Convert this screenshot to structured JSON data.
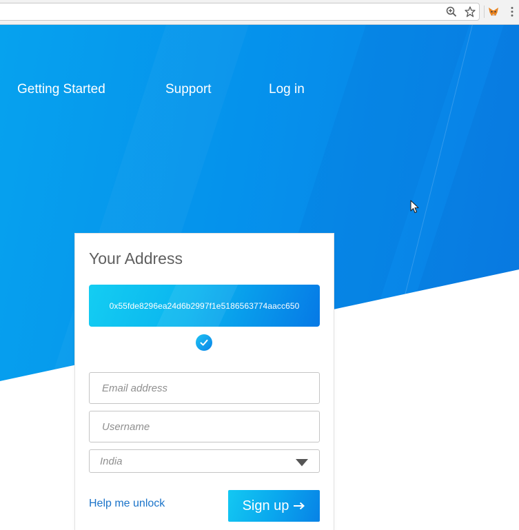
{
  "browser": {
    "zoom_icon": "zoom-in-icon",
    "bookmark_icon": "star-icon",
    "extension_icon": "metamask-fox-icon",
    "menu_icon": "kebab-menu-icon"
  },
  "nav": {
    "getting_started": "Getting Started",
    "support": "Support",
    "login": "Log in"
  },
  "card": {
    "title": "Your Address",
    "address": "0x55fde8296ea24d6b2997f1e5186563774aacc650",
    "verified_icon": "check-circle-icon",
    "email": {
      "value": "",
      "placeholder": "Email address"
    },
    "username": {
      "value": "",
      "placeholder": "Username"
    },
    "country": {
      "selected": "India"
    },
    "help_link": "Help me unlock",
    "signup_label": "Sign up",
    "signup_icon": "arrow-right-icon"
  },
  "colors": {
    "hero_blue": "#0592ec",
    "accent_cyan": "#14cdf2",
    "link_blue": "#1a73c9"
  }
}
